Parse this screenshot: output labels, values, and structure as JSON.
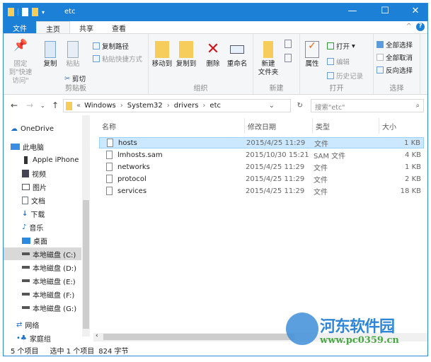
{
  "window": {
    "title": "etc",
    "minimize": "—",
    "maximize": "☐",
    "close": "✕"
  },
  "tabs": [
    {
      "label": "文件"
    },
    {
      "label": "主页"
    },
    {
      "label": "共享"
    },
    {
      "label": "查看"
    }
  ],
  "ribbon": {
    "clipboard": {
      "pin": "固定到\"快速访问\"",
      "copy": "复制",
      "paste": "粘贴",
      "copy_path": "复制路径",
      "paste_shortcut": "粘贴快捷方式",
      "cut": "剪切",
      "label": "剪贴板"
    },
    "organize": {
      "move_to": "移动到",
      "copy_to": "复制到",
      "delete": "删除",
      "rename": "重命名",
      "label": "组织"
    },
    "new": {
      "new_folder": "新建\n文件夹",
      "label": "新建"
    },
    "open": {
      "properties": "属性",
      "open": "打开",
      "edit": "编辑",
      "history": "历史记录",
      "label": "打开"
    },
    "select": {
      "select_all": "全部选择",
      "select_none": "全部取消",
      "invert": "反向选择",
      "label": "选择"
    }
  },
  "address": {
    "prefix": "«",
    "path": [
      "Windows",
      "System32",
      "drivers",
      "etc"
    ],
    "search_placeholder": "搜索\"etc\""
  },
  "sidebar": [
    {
      "label": "OneDrive",
      "icon": "cloud-icon"
    },
    {
      "label": "此电脑",
      "icon": "computer-icon"
    },
    {
      "label": "Apple iPhone",
      "icon": "phone-icon"
    },
    {
      "label": "视频",
      "icon": "video-icon"
    },
    {
      "label": "图片",
      "icon": "pictures-icon"
    },
    {
      "label": "文档",
      "icon": "documents-icon"
    },
    {
      "label": "下载",
      "icon": "download-icon"
    },
    {
      "label": "音乐",
      "icon": "music-icon"
    },
    {
      "label": "桌面",
      "icon": "desktop-icon"
    },
    {
      "label": "本地磁盘 (C:)",
      "icon": "drive-icon"
    },
    {
      "label": "本地磁盘 (D:)",
      "icon": "drive-icon"
    },
    {
      "label": "本地磁盘 (E:)",
      "icon": "drive-icon"
    },
    {
      "label": "本地磁盘 (F:)",
      "icon": "drive-icon"
    },
    {
      "label": "本地磁盘 (G:)",
      "icon": "drive-icon"
    },
    {
      "label": "网络",
      "icon": "network-icon"
    },
    {
      "label": "家庭组",
      "icon": "homegroup-icon"
    }
  ],
  "columns": [
    "名称",
    "修改日期",
    "类型",
    "大小"
  ],
  "files": [
    {
      "name": "hosts",
      "date": "2015/4/25 11:29",
      "type": "文件",
      "size": "1 KB"
    },
    {
      "name": "lmhosts.sam",
      "date": "2015/10/30 15:21",
      "type": "SAM 文件",
      "size": "4 KB"
    },
    {
      "name": "networks",
      "date": "2015/4/25 11:29",
      "type": "文件",
      "size": "1 KB"
    },
    {
      "name": "protocol",
      "date": "2015/4/25 11:29",
      "type": "文件",
      "size": "2 KB"
    },
    {
      "name": "services",
      "date": "2015/4/25 11:29",
      "type": "文件",
      "size": "18 KB"
    }
  ],
  "status": {
    "count": "5 个项目",
    "selected": "选中 1 个项目",
    "size": "824 字节"
  },
  "watermark": {
    "name": "河东软件园",
    "url": "www.pc0359.cn"
  },
  "colors": {
    "accent": "#1c80d6",
    "selection": "#cce8ff"
  }
}
